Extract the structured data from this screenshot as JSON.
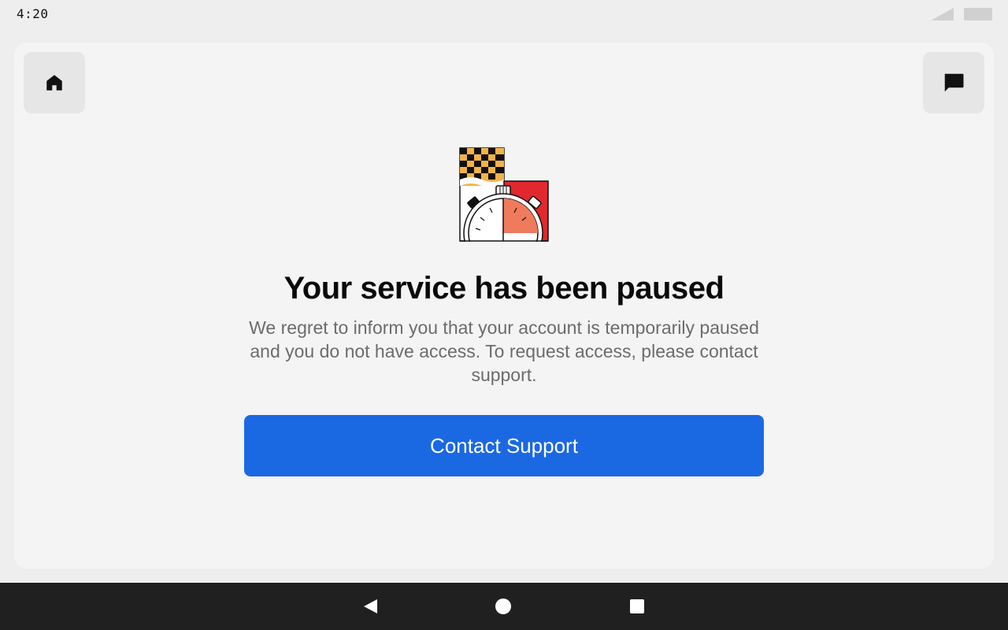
{
  "status_bar": {
    "time": "4:20",
    "icons": [
      "signal-icon",
      "battery-icon"
    ]
  },
  "header": {
    "home_icon": "home-icon",
    "chat_icon": "chat-icon"
  },
  "main": {
    "illustration": "checkered-flag-stopwatch-illustration",
    "title": "Your service has been paused",
    "message": "We regret to inform you that your account is temporarily paused and you do not have access. To request access, please contact support.",
    "cta_label": "Contact Support"
  },
  "nav_bar": {
    "icons": [
      "back-icon",
      "home-circle-icon",
      "recents-icon"
    ]
  },
  "colors": {
    "accent": "#1b68e3",
    "flag_orange": "#f5b24a",
    "stopwatch_red": "#e0282e",
    "stopwatch_salmon": "#f07a5c"
  }
}
